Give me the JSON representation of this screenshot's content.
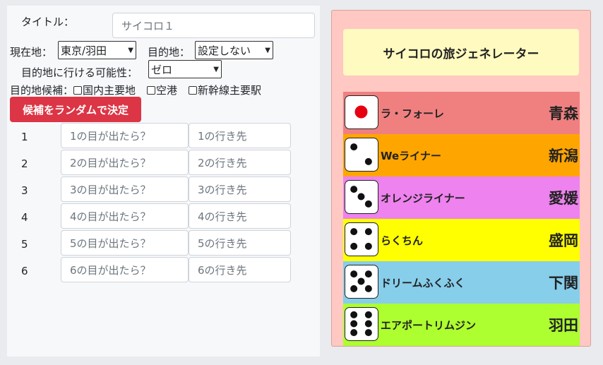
{
  "form": {
    "title_label": "タイトル：",
    "title_value": "サイコロ１",
    "current_label": "現在地：",
    "current_value": "東京/羽田",
    "destination_label": "目的地：",
    "destination_value": "設定しない",
    "possibility_label": "目的地に行ける可能性：",
    "possibility_value": "ゼロ",
    "candidates_label": "目的地候補：",
    "candidates": [
      "国内主要地",
      "空港",
      "新幹線主要駅"
    ],
    "random_button": "候補をランダムで決定",
    "rows": [
      {
        "num": "1",
        "roll_placeholder": "1の目が出たら？",
        "dest_placeholder": "1の行き先"
      },
      {
        "num": "2",
        "roll_placeholder": "2の目が出たら？",
        "dest_placeholder": "2の行き先"
      },
      {
        "num": "3",
        "roll_placeholder": "3の目が出たら？",
        "dest_placeholder": "3の行き先"
      },
      {
        "num": "4",
        "roll_placeholder": "4の目が出たら？",
        "dest_placeholder": "4の行き先"
      },
      {
        "num": "5",
        "roll_placeholder": "5の目が出たら？",
        "dest_placeholder": "5の行き先"
      },
      {
        "num": "6",
        "roll_placeholder": "6の目が出たら？",
        "dest_placeholder": "6の行き先"
      }
    ]
  },
  "generator": {
    "title": "サイコロの旅ジェネレーター",
    "dice": [
      {
        "face": 1,
        "name": "ラ・フォーレ",
        "destination": "青森",
        "color": "#f08080"
      },
      {
        "face": 2,
        "name": "Weライナー",
        "destination": "新潟",
        "color": "#ffa500"
      },
      {
        "face": 3,
        "name": "オレンジライナー",
        "destination": "愛媛",
        "color": "#ee82ee"
      },
      {
        "face": 4,
        "name": "らくちん",
        "destination": "盛岡",
        "color": "#ffff00"
      },
      {
        "face": 5,
        "name": "ドリームふくふく",
        "destination": "下関",
        "color": "#87ceeb"
      },
      {
        "face": 6,
        "name": "エアポートリムジン",
        "destination": "羽田",
        "color": "#adff2f"
      }
    ]
  }
}
